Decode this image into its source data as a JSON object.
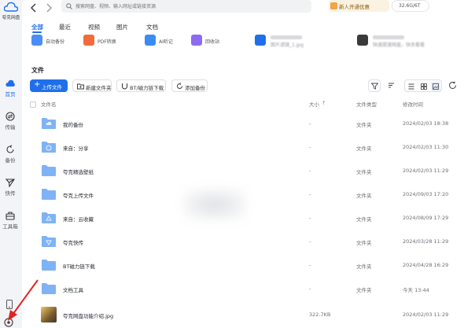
{
  "app": {
    "logo_text": "夸克网盘",
    "colors": {
      "accent": "#1f6feb",
      "vip_bg": "#fbf3e2",
      "folder": "#7fb3f5",
      "arrow": "#e02424"
    }
  },
  "sidebar": {
    "items": [
      {
        "label": "首页",
        "icon": "home-cloud-icon",
        "active": true
      },
      {
        "label": "传输",
        "icon": "transfer-icon"
      },
      {
        "label": "备份",
        "icon": "backup-icon"
      },
      {
        "label": "快传",
        "icon": "quick-send-icon"
      },
      {
        "label": "工具箱",
        "icon": "toolbox-icon"
      }
    ],
    "bottom_icons": [
      "phone-icon",
      "settings-icon"
    ]
  },
  "header": {
    "search_placeholder": "搜索网盘、视频、输入网址或链接资源",
    "vip_label": "新人开通优惠",
    "storage": "32.6G/6T"
  },
  "tabs": [
    {
      "label": "全部",
      "active": true
    },
    {
      "label": "最近"
    },
    {
      "label": "视频"
    },
    {
      "label": "图片"
    },
    {
      "label": "文档"
    }
  ],
  "quick_tools": [
    {
      "label": "自动备份",
      "icon": "auto-backup-icon",
      "color": "#4a8df8"
    },
    {
      "label": "PDF转换",
      "icon": "pdf-convert-icon",
      "color": "#f26b3a"
    },
    {
      "label": "AI听记",
      "icon": "ai-transcribe-icon",
      "color": "#3a8cf2"
    },
    {
      "label": "回收站",
      "icon": "recycle-bin-icon",
      "color": "#8a6bf2"
    }
  ],
  "recent_files": [
    {
      "caption": "图片滤镜_1.jpg"
    },
    {
      "caption": "快速提速网盘，快去看看"
    }
  ],
  "files_section": {
    "title": "文件",
    "upload_label": "上传文件",
    "new_folder_label": "新建文件夹",
    "bt_label": "BT/磁力链下载",
    "add_backup_label": "添加备份"
  },
  "table": {
    "columns": {
      "name": "文件名",
      "size": "大小",
      "type": "文件类型",
      "modified": "修改时间"
    },
    "rows": [
      {
        "name": "我的备份",
        "size": "-",
        "type": "文件夹",
        "modified": "2024/02/03 18:38",
        "kind": "backup-folder"
      },
      {
        "name": "来自：分享",
        "size": "-",
        "type": "文件夹",
        "modified": "2024/02/03 11:30",
        "kind": "share-folder"
      },
      {
        "name": "夸克精选壁纸",
        "size": "-",
        "type": "文件夹",
        "modified": "2024/02/03 11:29",
        "kind": "folder"
      },
      {
        "name": "夸克上传文件",
        "size": "-",
        "type": "文件夹",
        "modified": "2024/09/03 17:20",
        "kind": "folder"
      },
      {
        "name": "来自：云收藏",
        "size": "-",
        "type": "文件夹",
        "modified": "2024/08/09 17:29",
        "kind": "cloud-folder"
      },
      {
        "name": "夸克快传",
        "size": "-",
        "type": "文件夹",
        "modified": "2024/03/28 11:29",
        "kind": "quick-folder"
      },
      {
        "name": "BT磁力链下载",
        "size": "-",
        "type": "文件夹",
        "modified": "2024/04/28 16:29",
        "kind": "folder"
      },
      {
        "name": "文档工具",
        "size": "-",
        "type": "文件夹",
        "modified": "今天 13:44",
        "kind": "folder"
      },
      {
        "name": "夸克网盘功能介绍.jpg",
        "size": "322.7KB",
        "type": "",
        "modified": "2024/02/03 11:29",
        "kind": "image"
      }
    ]
  }
}
